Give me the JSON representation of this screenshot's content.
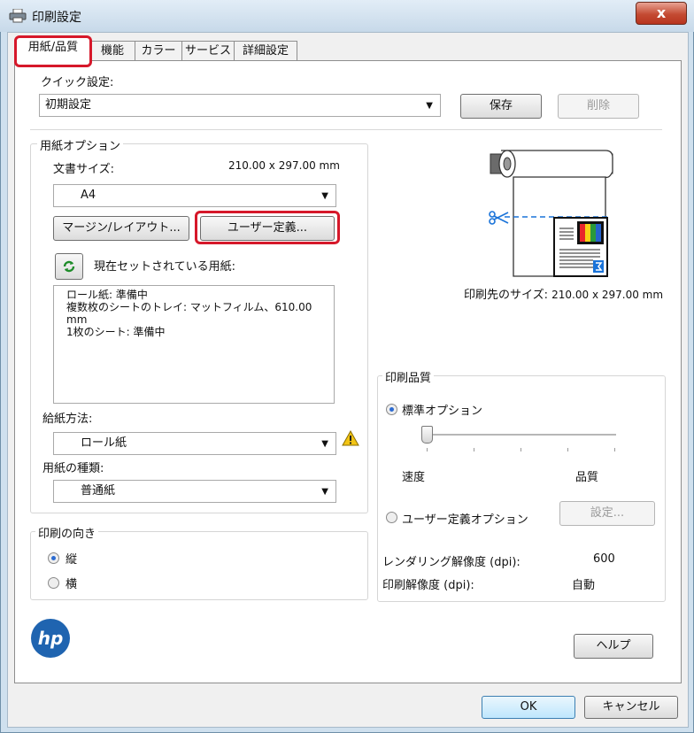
{
  "window": {
    "title": "印刷設定",
    "close_glyph": "x"
  },
  "tabs": [
    {
      "label": "用紙/品質",
      "active": true
    },
    {
      "label": "機能"
    },
    {
      "label": "カラー"
    },
    {
      "label": "サービス"
    },
    {
      "label": "詳細設定"
    }
  ],
  "quick": {
    "label": "クイック設定:",
    "value": "初期設定",
    "save": "保存",
    "delete": "削除"
  },
  "paper": {
    "group_title": "用紙オプション",
    "doc_size_label": "文書サイズ:",
    "doc_size_value": "210.00 x 297.00 mm",
    "size_select": "A4",
    "margin_button": "マージン/レイアウト...",
    "custom_button": "ユーザー定義...",
    "current_label": "現在セットされている用紙:",
    "current_lines": [
      "ロール紙: 準備中",
      "複数枚のシートのトレイ: マットフィルム、610.00 mm",
      "1枚のシート: 準備中"
    ],
    "source_label": "給紙方法:",
    "source_value": "ロール紙",
    "type_label": "用紙の種類:",
    "type_value": "普通紙"
  },
  "preview": {
    "print_size_label": "印刷先のサイズ:",
    "print_size_value": "210.00 x 297.00 mm"
  },
  "orientation": {
    "title": "印刷の向き",
    "portrait": "縦",
    "landscape": "横",
    "selected": "portrait"
  },
  "quality": {
    "title": "印刷品質",
    "standard": "標準オプション",
    "speed": "速度",
    "quality": "品質",
    "custom": "ユーザー定義オプション",
    "settings": "設定...",
    "rendering_label": "レンダリング解像度 (dpi):",
    "rendering_value": "600",
    "print_res_label": "印刷解像度 (dpi):",
    "print_res_value": "自動",
    "slider_level": 0
  },
  "logo": "hp",
  "help": "ヘルプ",
  "footer": {
    "ok": "OK",
    "cancel": "キャンセル"
  },
  "colors": {
    "accent": "#2c6bd1",
    "highlight": "#d6182a",
    "cut": "#1a73d9"
  }
}
